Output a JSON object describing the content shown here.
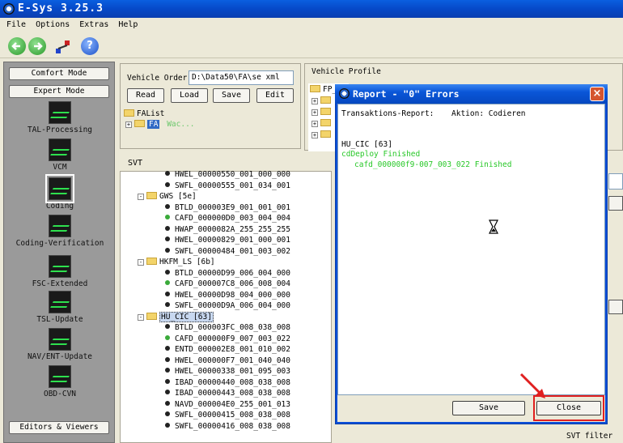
{
  "app": {
    "title": "E-Sys 3.25.3"
  },
  "menu": {
    "items": [
      "File",
      "Options",
      "Extras",
      "Help"
    ]
  },
  "left": {
    "comfort_mode": "Comfort Mode",
    "expert_mode": "Expert Mode",
    "modules": [
      "TAL-Processing",
      "VCM",
      "Coding",
      "Coding-Verification",
      "FSC-Extended",
      "TSL-Update",
      "NAV/ENT-Update",
      "OBD-CVN"
    ],
    "editors_viewers": "Editors & Viewers"
  },
  "vehicle_order": {
    "label": "Vehicle Order",
    "path": "D:\\Data50\\FA\\se        xml",
    "read": "Read",
    "load": "Load",
    "save": "Save",
    "edit": "Edit",
    "falist": "FAList",
    "fa": "FA",
    "fa_note": "Wac..."
  },
  "vehicle_profile": {
    "label": "Vehicle Profile",
    "fp": "FP_V"
  },
  "svt": {
    "label": "SVT",
    "rows": [
      {
        "type": "item",
        "text": "HWEL_00000550_001_000_000",
        "green": false
      },
      {
        "type": "item",
        "text": "SWFL_00000555_001_034_001",
        "green": false
      },
      {
        "type": "group",
        "text": "GWS [5e]"
      },
      {
        "type": "item",
        "text": "BTLD_000003E9_001_001_001",
        "green": false
      },
      {
        "type": "item",
        "text": "CAFD_000000D0_003_004_004",
        "green": true
      },
      {
        "type": "item",
        "text": "HWAP_0000082A_255_255_255",
        "green": false
      },
      {
        "type": "item",
        "text": "HWEL_00000829_001_000_001",
        "green": false
      },
      {
        "type": "item",
        "text": "SWFL_00000484_001_003_002",
        "green": false
      },
      {
        "type": "group",
        "text": "HKFM_LS [6b]"
      },
      {
        "type": "item",
        "text": "BTLD_00000D99_006_004_000",
        "green": false
      },
      {
        "type": "item",
        "text": "CAFD_000007C8_006_008_004",
        "green": true
      },
      {
        "type": "item",
        "text": "HWEL_00000D98_004_000_000",
        "green": false
      },
      {
        "type": "item",
        "text": "SWFL_00000D9A_006_004_000",
        "green": false
      },
      {
        "type": "group",
        "text": "HU_CIC [63]",
        "selected": true
      },
      {
        "type": "item",
        "text": "BTLD_000003FC_008_038_008",
        "green": false
      },
      {
        "type": "item",
        "text": "CAFD_000000F9_007_003_022",
        "green": true
      },
      {
        "type": "item",
        "text": "ENTD_000002E8_001_010_002",
        "green": false
      },
      {
        "type": "item",
        "text": "HWEL_000000F7_001_040_040",
        "green": false
      },
      {
        "type": "item",
        "text": "HWEL_00000338_001_095_003",
        "green": false
      },
      {
        "type": "item",
        "text": "IBAD_00000440_008_038_008",
        "green": false
      },
      {
        "type": "item",
        "text": "IBAD_00000443_008_038_008",
        "green": false
      },
      {
        "type": "item",
        "text": "NAVD_000004E0_255_001_013",
        "green": false
      },
      {
        "type": "item",
        "text": "SWFL_00000415_008_038_008",
        "green": false
      },
      {
        "type": "item",
        "text": "SWFL_00000416_008_038_008",
        "green": false
      }
    ]
  },
  "dialog": {
    "title": "Report - \"0\" Errors",
    "report_label": "Transaktions-Report:",
    "action_label": "Aktion: Codieren",
    "ecu": "HU_CIC [63]",
    "deploy": "cdDeploy Finished",
    "cafd": "cafd_000000f9-007_003_022 Finished",
    "save": "Save",
    "close": "Close"
  },
  "right": {
    "svt_filter": "SVT filter"
  },
  "colors": {
    "green_text": "#28c828",
    "highlight": "#e02020",
    "title_blue": "#0a56d8"
  }
}
